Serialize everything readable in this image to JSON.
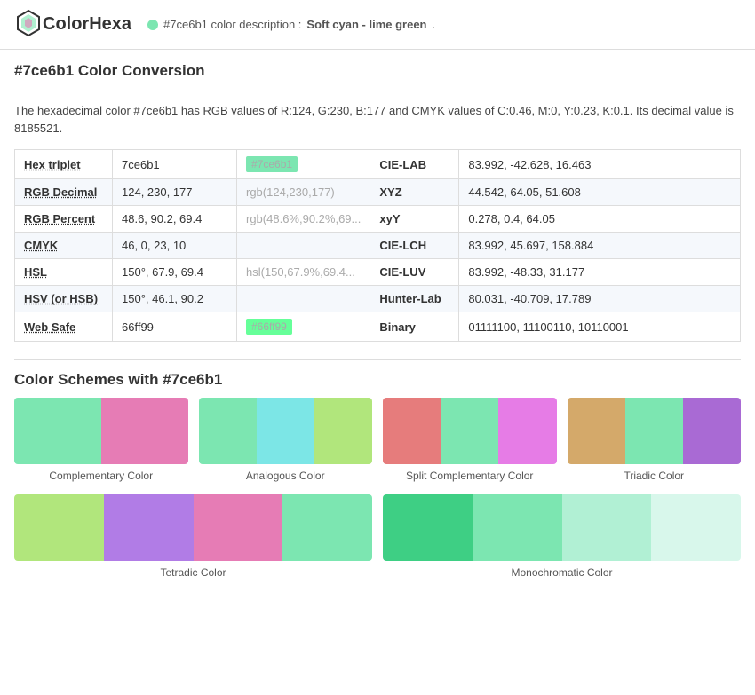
{
  "header": {
    "logo_name": "ColorHexa",
    "logo_bold": "Hexa",
    "logo_plain": "Color",
    "color_hex": "#7ce6b1",
    "description": "#7ce6b1 color description :",
    "color_name": "Soft cyan - lime green",
    "color_dot": "#7ce6b1"
  },
  "main": {
    "conversion_title": "#7ce6b1 Color Conversion",
    "desc_text": "The hexadecimal color #7ce6b1 has RGB values of R:124, G:230, B:177 and CMYK values of C:0.46, M:0, Y:0.23, K:0.1. Its decimal value is 8185521.",
    "table": {
      "rows": [
        {
          "label": "Hex triplet",
          "value": "7ce6b1",
          "preview": "#7ce6b1",
          "preview_is_swatch": true,
          "right_label": "CIE-LAB",
          "right_value": "83.992, -42.628, 16.463"
        },
        {
          "label": "RGB Decimal",
          "value": "124, 230, 177",
          "preview": "rgb(124,230,177)",
          "preview_is_swatch": false,
          "right_label": "XYZ",
          "right_value": "44.542, 64.05, 51.608"
        },
        {
          "label": "RGB Percent",
          "value": "48.6, 90.2, 69.4",
          "preview": "rgb(48.6%,90.2%,69...",
          "preview_is_swatch": false,
          "right_label": "xyY",
          "right_value": "0.278, 0.4, 64.05"
        },
        {
          "label": "CMYK",
          "value": "46, 0, 23, 10",
          "preview": "",
          "preview_is_swatch": false,
          "right_label": "CIE-LCH",
          "right_value": "83.992, 45.697, 158.884"
        },
        {
          "label": "HSL",
          "value": "150°, 67.9, 69.4",
          "preview": "hsl(150,67.9%,69.4...",
          "preview_is_swatch": false,
          "right_label": "CIE-LUV",
          "right_value": "83.992, -48.33, 31.177"
        },
        {
          "label": "HSV (or HSB)",
          "value": "150°, 46.1, 90.2",
          "preview": "",
          "preview_is_swatch": false,
          "right_label": "Hunter-Lab",
          "right_value": "80.031, -40.709, 17.789"
        },
        {
          "label": "Web Safe",
          "value": "66ff99",
          "preview": "#66ff99",
          "preview_is_swatch": true,
          "preview_color": "#66ff99",
          "right_label": "Binary",
          "right_value": "01111100, 11100110, 10110001"
        }
      ]
    },
    "schemes_title": "Color Schemes with #7ce6b1",
    "schemes": [
      {
        "label": "Complementary Color",
        "parts": [
          "#7ce6b1",
          "#e67cb5"
        ]
      },
      {
        "label": "Analogous Color",
        "parts": [
          "#7ce6b1",
          "#7ce6e6",
          "#b1e67c"
        ]
      },
      {
        "label": "Split Complementary Color",
        "parts": [
          "#e67c7c",
          "#7ce6b1",
          "#e67ce6"
        ]
      },
      {
        "label": "Triadic Color",
        "parts": [
          "#d4a96a",
          "#7ce6b1",
          "#a96ad4"
        ]
      },
      {
        "label": "Tetradic Color",
        "parts": [
          "#b1e67c",
          "#b17ce6",
          "#e67cb5",
          "#7ce6b1"
        ]
      },
      {
        "label": "Monochromatic Color",
        "parts": [
          "#3ecf84",
          "#7ce6b1",
          "#b1f0d4",
          "#d8f7eb"
        ]
      }
    ]
  }
}
